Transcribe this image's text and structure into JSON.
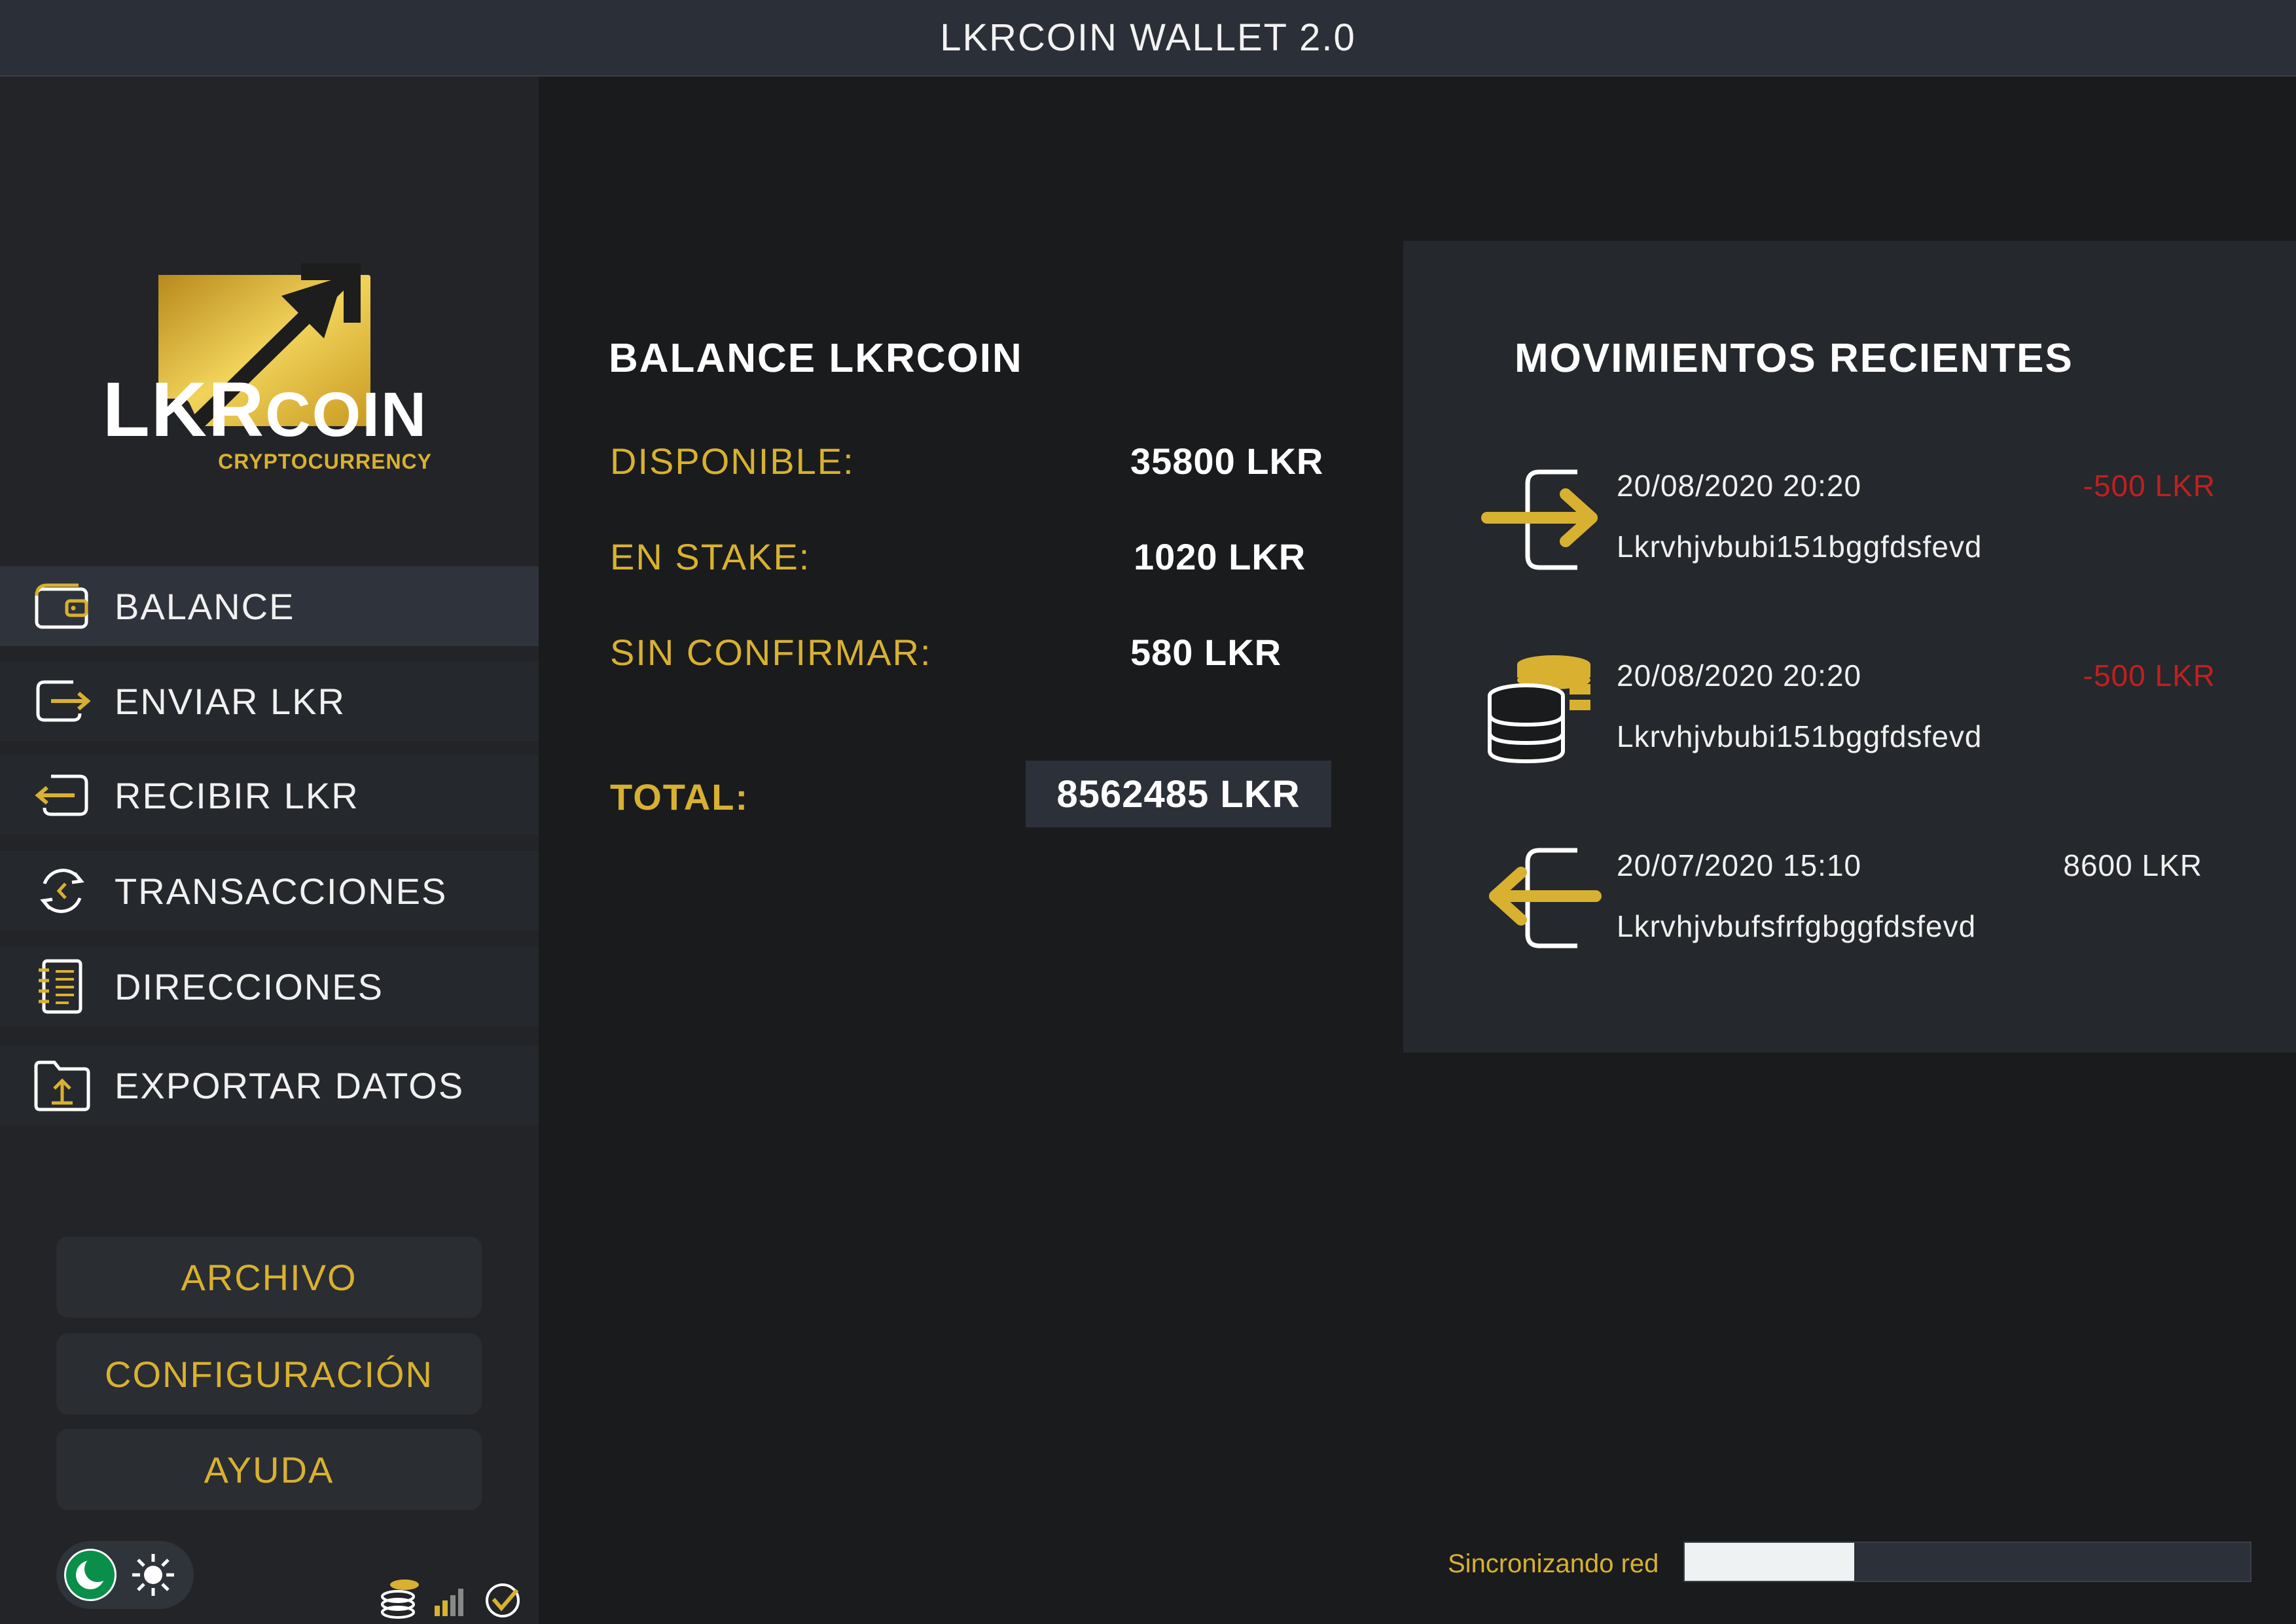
{
  "window": {
    "title": "LKRCOIN WALLET 2.0"
  },
  "logo": {
    "main": "LKR",
    "main_small": "COIN",
    "sub": "CRYPTOCURRENCY"
  },
  "nav": [
    {
      "label": "BALANCE",
      "icon": "wallet-icon",
      "active": true
    },
    {
      "label": "ENVIAR LKR",
      "icon": "send-icon",
      "active": false
    },
    {
      "label": "RECIBIR LKR",
      "icon": "receive-icon",
      "active": false
    },
    {
      "label": "TRANSACCIONES",
      "icon": "transactions-icon",
      "active": false
    },
    {
      "label": "DIRECCIONES",
      "icon": "address-book-icon",
      "active": false
    },
    {
      "label": "EXPORTAR DATOS",
      "icon": "export-icon",
      "active": false
    }
  ],
  "menu": {
    "archivo": "ARCHIVO",
    "configuracion": "CONFIGURACIÓN",
    "ayuda": "AYUDA"
  },
  "balance": {
    "title": "BALANCE LKRCOIN",
    "rows": [
      {
        "label": "DISPONIBLE:",
        "value": "35800 LKR"
      },
      {
        "label": "EN STAKE:",
        "value": "1020 LKR"
      },
      {
        "label": "SIN CONFIRMAR:",
        "value": "580 LKR"
      }
    ],
    "total_label": "TOTAL:",
    "total_value": "8562485 LKR"
  },
  "recent": {
    "title": "MOVIMIENTOS RECIENTES",
    "items": [
      {
        "type": "send-icon",
        "date": "20/08/2020 20:20",
        "amount": "-500 LKR",
        "amount_color": "#c0201f",
        "address": "Lkrvhjvbubi151bggfdsfevd"
      },
      {
        "type": "coins-icon",
        "date": "20/08/2020 20:20",
        "amount": "-500 LKR",
        "amount_color": "#c0201f",
        "address": "Lkrvhjvbubi151bggfdsfevd"
      },
      {
        "type": "receive-icon",
        "date": "20/07/2020 15:10",
        "amount": "8600 LKR",
        "amount_color": "#f0f0f0",
        "address": "Lkrvhjvbufsfrfgbggfdsfevd"
      }
    ]
  },
  "sync": {
    "label": "Sincronizando red",
    "progress": 0.3
  },
  "colors": {
    "accent": "#d8b130",
    "negative": "#c0201f",
    "green": "#0a8f4a"
  }
}
